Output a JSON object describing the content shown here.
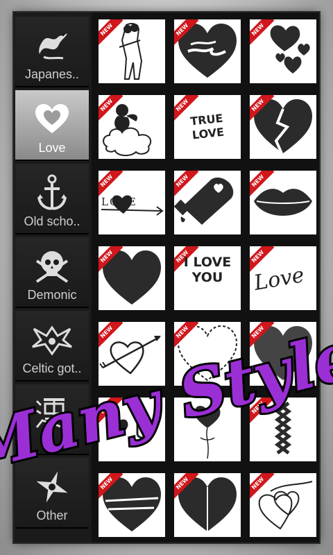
{
  "categories": [
    {
      "label": "Japanes..",
      "icon": "dragon-icon",
      "selected": false
    },
    {
      "label": "Love",
      "icon": "heart-icon",
      "selected": true
    },
    {
      "label": "Old scho..",
      "icon": "anchor-icon",
      "selected": false
    },
    {
      "label": "Demonic",
      "icon": "skull-icon",
      "selected": false
    },
    {
      "label": "Celtic got..",
      "icon": "tribal-icon",
      "selected": false
    },
    {
      "label": "",
      "icon": "kanji-icon",
      "selected": false
    },
    {
      "label": "Other",
      "icon": "shuriken-icon",
      "selected": false
    }
  ],
  "badge": "NEW",
  "tiles": {
    "true_love": "TRUE LOVE",
    "love_arrow": "LOVE",
    "i_love_you": "I LOVE YOU",
    "love_script": "Love"
  },
  "overlay_text": "Many Style",
  "colors": {
    "accent": "#d0171c",
    "overlay": "#9b2fd6"
  }
}
